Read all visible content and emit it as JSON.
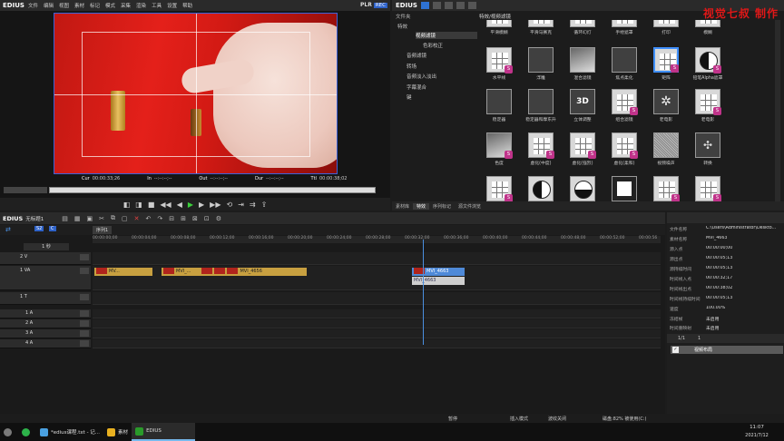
{
  "player": {
    "logo": "EDIUS",
    "menu": [
      "文件",
      "编辑",
      "视图",
      "素材",
      "标记",
      "模式",
      "采集",
      "渲染",
      "工具",
      "设置",
      "帮助"
    ],
    "plr": "PLR",
    "rec": "REC",
    "timecodes": [
      {
        "label": "Cur",
        "value": "00:00:33;26"
      },
      {
        "label": "In",
        "value": "--:--:--;--"
      },
      {
        "label": "Out",
        "value": "--:--:--;--"
      },
      {
        "label": "Dur",
        "value": "--:--:--;--"
      },
      {
        "label": "Ttl",
        "value": "00:00:38;02"
      }
    ]
  },
  "effects": {
    "logo": "EDIUS",
    "watermark": "视觉七叔 制作",
    "folder_label": "文件夹",
    "path": "特效/视频滤镜",
    "tree": [
      "特效",
      "视频滤镜",
      "色彩校正",
      "音频滤镜",
      "转场",
      "音频淡入淡出",
      "字幕混合",
      "键"
    ],
    "tiles": [
      "平滑模糊",
      "平滑马赛克",
      "循环幻灯",
      "手绘遮罩",
      "打印",
      "模糊",
      "水平线",
      "浮雕",
      "混合滤镜",
      "焦点柔化",
      "矩阵",
      "铅笔Alpha遮罩",
      "稳定器",
      "稳定器和摩东升",
      "立体调整",
      "组合滤镜",
      "老电影",
      "老电影",
      "色度",
      "虚化(中度)",
      "虚化(强烈)",
      "虚化(柔和)",
      "视频噪声",
      "转换",
      "",
      "",
      "",
      "",
      "",
      ""
    ],
    "tabs": [
      "素材库",
      "特效",
      "序列标记",
      "源文件浏览"
    ]
  },
  "timeline": {
    "logo": "EDIUS",
    "name": "无标题1",
    "seq_tab": "序列1",
    "ruler": [
      "00:00:00;00",
      "00:00:04;00",
      "00:00:08;00",
      "00:00:12;00",
      "00:00:16;00",
      "00:00:20;00",
      "00:00:24;00",
      "00:00:28;00",
      "00:00:32;00",
      "00:00:36;00",
      "00:00:40;00",
      "00:00:44;00",
      "00:00:48;00",
      "00:00:52;00",
      "00:00:56"
    ],
    "tracks": [
      "2 V",
      "1 VA",
      "1 T",
      "1 A",
      "2 A",
      "3 A",
      "4 A"
    ],
    "clip_labels": [
      "MV...",
      "MVI_...",
      "MVI_4656",
      "MVI_4663",
      "MVI_4663"
    ],
    "scale": "1 秒"
  },
  "info": {
    "rows": [
      {
        "k": "文件名称",
        "v": "C:\\Users\\Administrator\\Deskto..."
      },
      {
        "k": "素材名称",
        "v": "MVI_4663"
      },
      {
        "k": "源入点",
        "v": "00:00:00;00"
      },
      {
        "k": "源出点",
        "v": "00:00:05;13"
      },
      {
        "k": "源持续时间",
        "v": "00:00:05;13"
      },
      {
        "k": "时间线入点",
        "v": "00:00:32;17"
      },
      {
        "k": "时间线出点",
        "v": "00:00:38;02"
      },
      {
        "k": "时间线持续时间",
        "v": "00:00:05;13"
      },
      {
        "k": "速度",
        "v": "100.00%"
      },
      {
        "k": "冻结帧",
        "v": "未启用"
      },
      {
        "k": "时间重映射",
        "v": "未启用"
      }
    ],
    "page": "1/1",
    "count": "1",
    "item": "视频布局",
    "tab": "信息"
  },
  "status": {
    "stop": "暂停",
    "insert": "插入模式",
    "ripple": "波纹关闭",
    "disk": "磁盘:82% 被使用(C:)"
  },
  "taskbar": {
    "items": [
      "*edius课程.txt - 记...",
      "素材",
      "EDIUS"
    ],
    "time": "11:07",
    "date": "2021/7/12"
  }
}
